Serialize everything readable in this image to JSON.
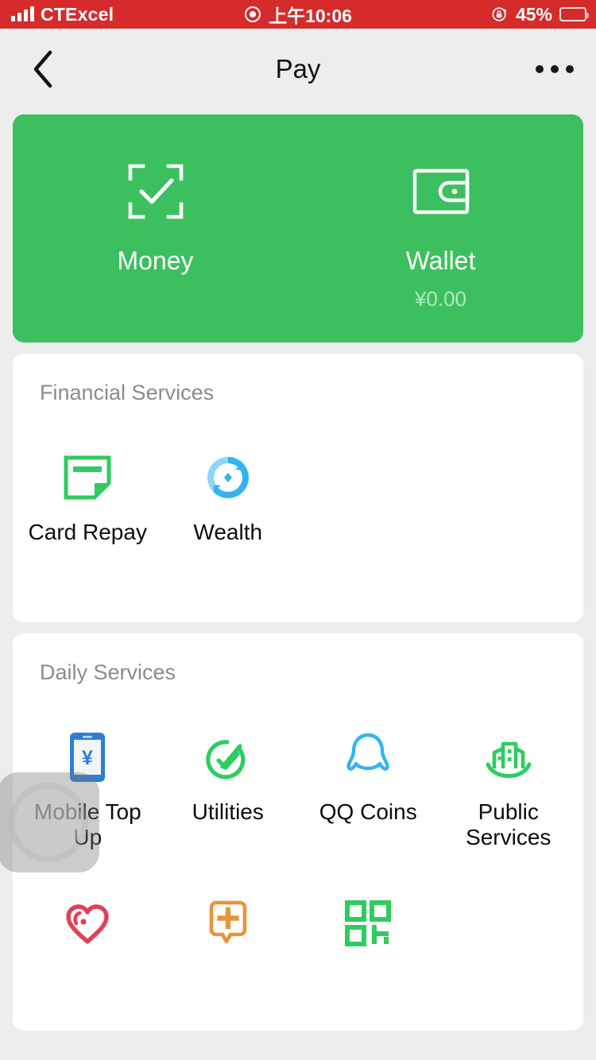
{
  "status_bar": {
    "carrier": "CTExcel",
    "signal_icon": "signal-bars-icon",
    "time": "上午10:06",
    "time_prefix_icon": "record-indicator-icon",
    "lock_icon": "rotation-lock-icon",
    "battery_percent": "45%",
    "battery_level": 45,
    "background_color": "#d52b2b"
  },
  "nav_bar": {
    "back_icon": "back-chevron-icon",
    "title": "Pay",
    "more_icon": "more-options-icon"
  },
  "quick_actions": {
    "background_color": "#3cc05f",
    "items": [
      {
        "label": "Money",
        "icon": "scan-check-icon",
        "sub": ""
      },
      {
        "label": "Wallet",
        "icon": "wallet-icon",
        "sub": "¥0.00"
      }
    ]
  },
  "financial_services": {
    "title": "Financial Services",
    "items": [
      {
        "label": "Card Repay",
        "icon": "credit-card-repay-icon",
        "color": "#2ecc5f"
      },
      {
        "label": "Wealth",
        "icon": "wealth-circulation-icon",
        "color": "#33b4ef"
      }
    ]
  },
  "daily_services": {
    "title": "Daily Services",
    "row1": [
      {
        "label": "Mobile Top Up",
        "icon": "mobile-topup-icon",
        "color": "#2b7fd4"
      },
      {
        "label": "Utilities",
        "icon": "utilities-check-icon",
        "color": "#2ecc5f"
      },
      {
        "label": "QQ Coins",
        "icon": "qq-penguin-icon",
        "color": "#33b4ef"
      },
      {
        "label": "Public Services",
        "icon": "public-services-buildings-icon",
        "color": "#2ecc5f"
      }
    ],
    "row2": [
      {
        "label": "",
        "icon": "charity-heart-icon",
        "color": "#e0405a"
      },
      {
        "label": "",
        "icon": "medical-consult-icon",
        "color": "#e8943a"
      },
      {
        "label": "",
        "icon": "qr-code-icon",
        "color": "#2ecc5f"
      }
    ]
  },
  "touch_indicator": {
    "name": "touch-pointer-overlay"
  }
}
